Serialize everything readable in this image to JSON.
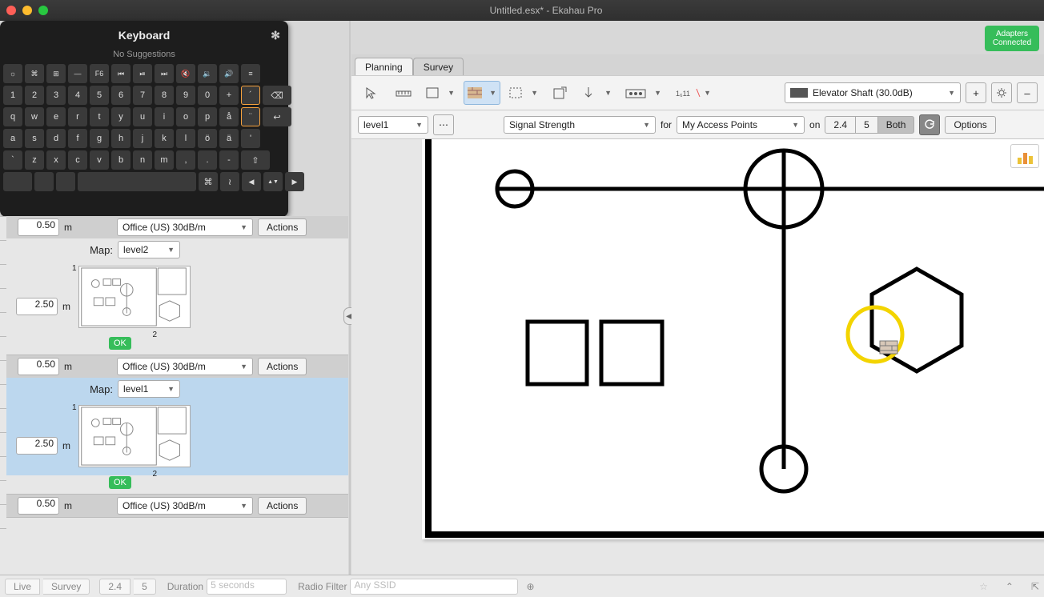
{
  "window": {
    "title": "Untitled.esx* - Ekahau Pro"
  },
  "adapters": {
    "line1": "Adapters",
    "line2": "Connected"
  },
  "keyboard": {
    "title": "Keyboard",
    "suggestions": "No Suggestions",
    "rows": {
      "fn": [
        "☼",
        "⌘",
        "⊞",
        "—",
        "F6",
        "⏮",
        "⏯",
        "⏭",
        "🔇",
        "🔉",
        "🔊",
        "≡"
      ],
      "num_top": [
        "!",
        "\"",
        "#",
        "$",
        "%",
        "&",
        "/",
        "(",
        ")",
        "=",
        "?",
        ""
      ],
      "num": [
        "1",
        "2",
        "3",
        "4",
        "5",
        "6",
        "7",
        "8",
        "9",
        "0",
        "+",
        "´",
        "⌫"
      ],
      "r1": [
        "q",
        "w",
        "e",
        "r",
        "t",
        "y",
        "u",
        "i",
        "o",
        "p",
        "å",
        "¨",
        "↩"
      ],
      "r2": [
        "a",
        "s",
        "d",
        "f",
        "g",
        "h",
        "j",
        "k",
        "l",
        "ö",
        "ä",
        "'"
      ],
      "r3": [
        "`",
        "z",
        "x",
        "c",
        "v",
        "b",
        "n",
        "m",
        ",",
        ".",
        "-",
        "⇧"
      ],
      "r4": [
        "",
        "",
        "",
        "",
        "⌘",
        "≀",
        "",
        "",
        "◀",
        "▲▼",
        "▶"
      ]
    }
  },
  "sidebar": {
    "floors": [
      {
        "floor_thickness": "0.50",
        "unit": "m",
        "floor_material": "Office (US) 30dB/m",
        "actions": "Actions",
        "map_label": "Map:",
        "map_value": "level2",
        "height": "2.50",
        "height_unit": "m",
        "status": "OK",
        "marker_top": "1",
        "marker_bottom": "2"
      },
      {
        "floor_thickness": "0.50",
        "unit": "m",
        "floor_material": "Office (US) 30dB/m",
        "actions": "Actions",
        "map_label": "Map:",
        "map_value": "level1",
        "height": "2.50",
        "height_unit": "m",
        "status": "OK",
        "marker_top": "1",
        "marker_bottom": "2",
        "selected": true
      },
      {
        "floor_thickness": "0.50",
        "unit": "m",
        "floor_material": "Office (US) 30dB/m",
        "actions": "Actions"
      }
    ]
  },
  "bottombar": {
    "live": "Live",
    "survey": "Survey",
    "b24": "2.4",
    "b5": "5",
    "duration_label": "Duration",
    "duration_value": "5 seconds",
    "radio_filter_label": "Radio Filter",
    "radio_filter_value": "Any SSID"
  },
  "main": {
    "tabs": {
      "planning": "Planning",
      "survey": "Survey"
    },
    "toolbar": {
      "material": "Elevator Shaft (30.0dB)",
      "plus": "+",
      "minus": "–"
    },
    "toolbar2": {
      "floor": "level1",
      "metric": "Signal Strength",
      "for": "for",
      "aps": "My Access Points",
      "on": "on",
      "b24": "2.4",
      "b5": "5",
      "both": "Both",
      "options": "Options"
    }
  }
}
